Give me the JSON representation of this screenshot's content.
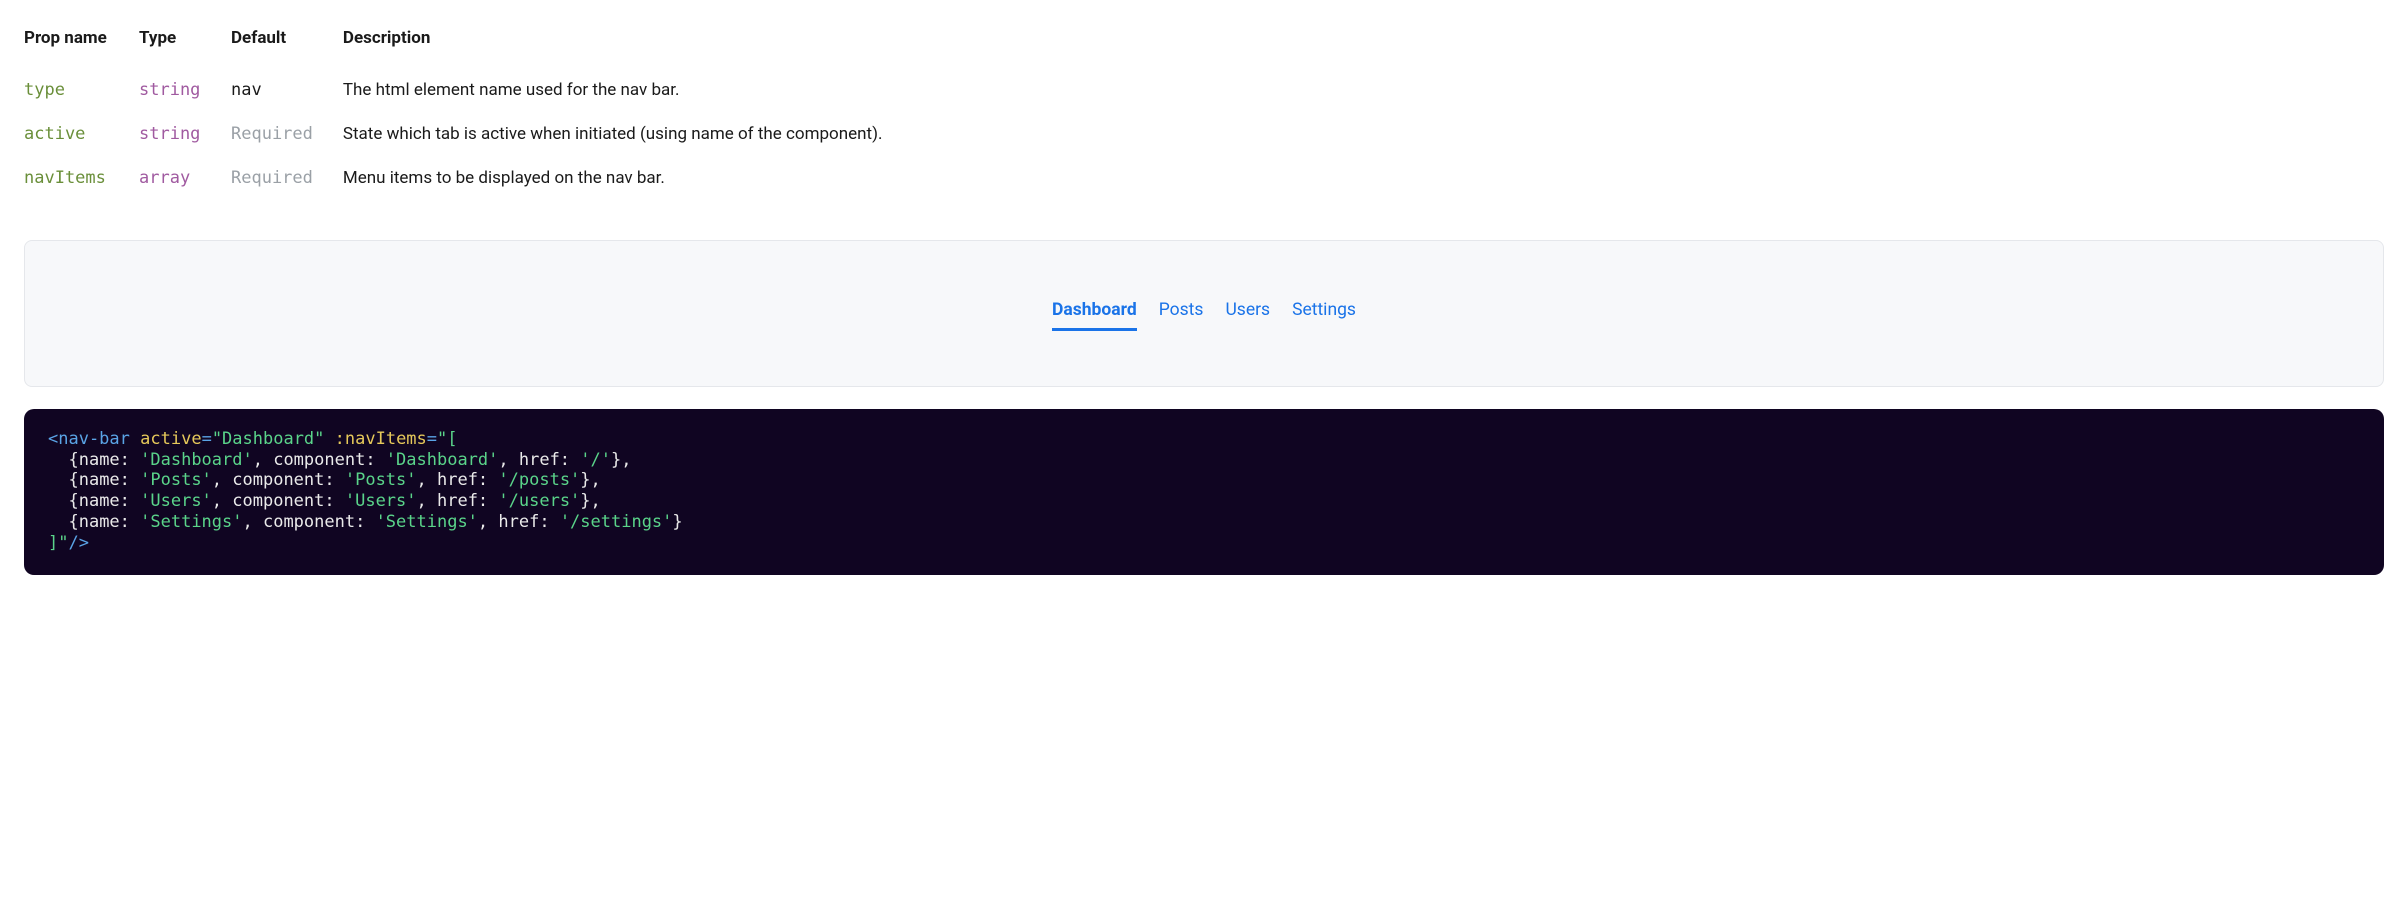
{
  "propsTable": {
    "headers": {
      "propName": "Prop name",
      "type": "Type",
      "default": "Default",
      "description": "Description"
    },
    "rows": [
      {
        "name": "type",
        "type": "string",
        "default": "nav",
        "defaultKind": "value",
        "description": "The html element name used for the nav bar."
      },
      {
        "name": "active",
        "type": "string",
        "default": "Required",
        "defaultKind": "required",
        "description": "State which tab is active when initiated (using name of the component)."
      },
      {
        "name": "navItems",
        "type": "array",
        "default": "Required",
        "defaultKind": "required",
        "description": "Menu items to be displayed on the nav bar."
      }
    ]
  },
  "navDemo": {
    "active": "Dashboard",
    "items": [
      {
        "label": "Dashboard"
      },
      {
        "label": "Posts"
      },
      {
        "label": "Users"
      },
      {
        "label": "Settings"
      }
    ]
  },
  "code": {
    "tokens": [
      {
        "cls": "tok-blue",
        "text": "<nav-bar"
      },
      {
        "cls": "tok-white",
        "text": " "
      },
      {
        "cls": "tok-yellow",
        "text": "active"
      },
      {
        "cls": "tok-blue",
        "text": "="
      },
      {
        "cls": "tok-string",
        "text": "\"Dashboard\""
      },
      {
        "cls": "tok-white",
        "text": " "
      },
      {
        "cls": "tok-yellow",
        "text": ":navItems"
      },
      {
        "cls": "tok-blue",
        "text": "="
      },
      {
        "cls": "tok-string",
        "text": "\"["
      },
      {
        "cls": "tok-white",
        "text": "\n  "
      },
      {
        "cls": "tok-white",
        "text": "{name: "
      },
      {
        "cls": "tok-string",
        "text": "'Dashboard'"
      },
      {
        "cls": "tok-white",
        "text": ", component: "
      },
      {
        "cls": "tok-string",
        "text": "'Dashboard'"
      },
      {
        "cls": "tok-white",
        "text": ", href: "
      },
      {
        "cls": "tok-string",
        "text": "'/'"
      },
      {
        "cls": "tok-white",
        "text": "},"
      },
      {
        "cls": "tok-white",
        "text": "\n  "
      },
      {
        "cls": "tok-white",
        "text": "{name: "
      },
      {
        "cls": "tok-string",
        "text": "'Posts'"
      },
      {
        "cls": "tok-white",
        "text": ", component: "
      },
      {
        "cls": "tok-string",
        "text": "'Posts'"
      },
      {
        "cls": "tok-white",
        "text": ", href: "
      },
      {
        "cls": "tok-string",
        "text": "'/posts'"
      },
      {
        "cls": "tok-white",
        "text": "},"
      },
      {
        "cls": "tok-white",
        "text": "\n  "
      },
      {
        "cls": "tok-white",
        "text": "{name: "
      },
      {
        "cls": "tok-string",
        "text": "'Users'"
      },
      {
        "cls": "tok-white",
        "text": ", component: "
      },
      {
        "cls": "tok-string",
        "text": "'Users'"
      },
      {
        "cls": "tok-white",
        "text": ", href: "
      },
      {
        "cls": "tok-string",
        "text": "'/users'"
      },
      {
        "cls": "tok-white",
        "text": "},"
      },
      {
        "cls": "tok-white",
        "text": "\n  "
      },
      {
        "cls": "tok-white",
        "text": "{name: "
      },
      {
        "cls": "tok-string",
        "text": "'Settings'"
      },
      {
        "cls": "tok-white",
        "text": ", component: "
      },
      {
        "cls": "tok-string",
        "text": "'Settings'"
      },
      {
        "cls": "tok-white",
        "text": ", href: "
      },
      {
        "cls": "tok-string",
        "text": "'/settings'"
      },
      {
        "cls": "tok-white",
        "text": "}"
      },
      {
        "cls": "tok-white",
        "text": "\n"
      },
      {
        "cls": "tok-string",
        "text": "]\""
      },
      {
        "cls": "tok-blue",
        "text": "/>"
      }
    ]
  }
}
